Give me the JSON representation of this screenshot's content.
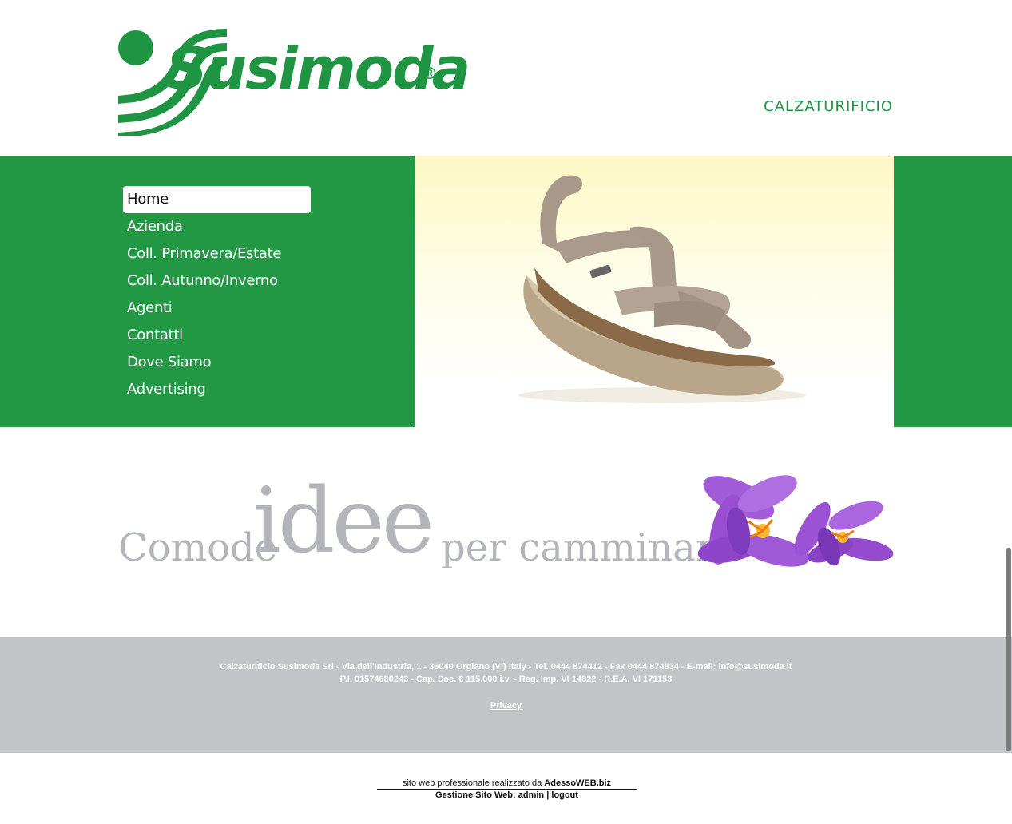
{
  "header": {
    "logo_text": "Susimoda",
    "logo_registered": "®",
    "tagline": "CALZATURIFICIO"
  },
  "menu": {
    "items": [
      {
        "label": "Home",
        "active": true
      },
      {
        "label": "Azienda",
        "active": false
      },
      {
        "label": "Coll. Primavera/Estate",
        "active": false
      },
      {
        "label": "Coll. Autunno/Inverno",
        "active": false
      },
      {
        "label": "Agenti",
        "active": false
      },
      {
        "label": "Contatti",
        "active": false
      },
      {
        "label": "Dove Siamo",
        "active": false
      },
      {
        "label": "Advertising",
        "active": false
      }
    ]
  },
  "slogan": {
    "part1": "Comode",
    "part2": "idee",
    "part3": "per camminare"
  },
  "footer": {
    "line1": "Calzaturificio Susimoda Srl - Via dell'Industria, 1 - 36040 Orgiano (VI) Italy - Tel. 0444 874412 - Fax 0444 874834 - E-mail: info@susimoda.it",
    "line2": "P.I. 01574680243 - Cap. Soc. € 115.000 i.v. - Reg. Imp. VI 14822 - R.E.A. VI 171153",
    "privacy": "Privacy"
  },
  "credit": {
    "prefix": "sito web professionale realizzato da ",
    "brand": "AdessoWEB.biz",
    "admin_label": "Gestione Sito Web: admin",
    "separator": "|",
    "logout": "logout"
  },
  "colors": {
    "brand_green": "#229845",
    "slogan_gray": "#b4b5ba",
    "footer_gray": "#c3c4c7"
  }
}
